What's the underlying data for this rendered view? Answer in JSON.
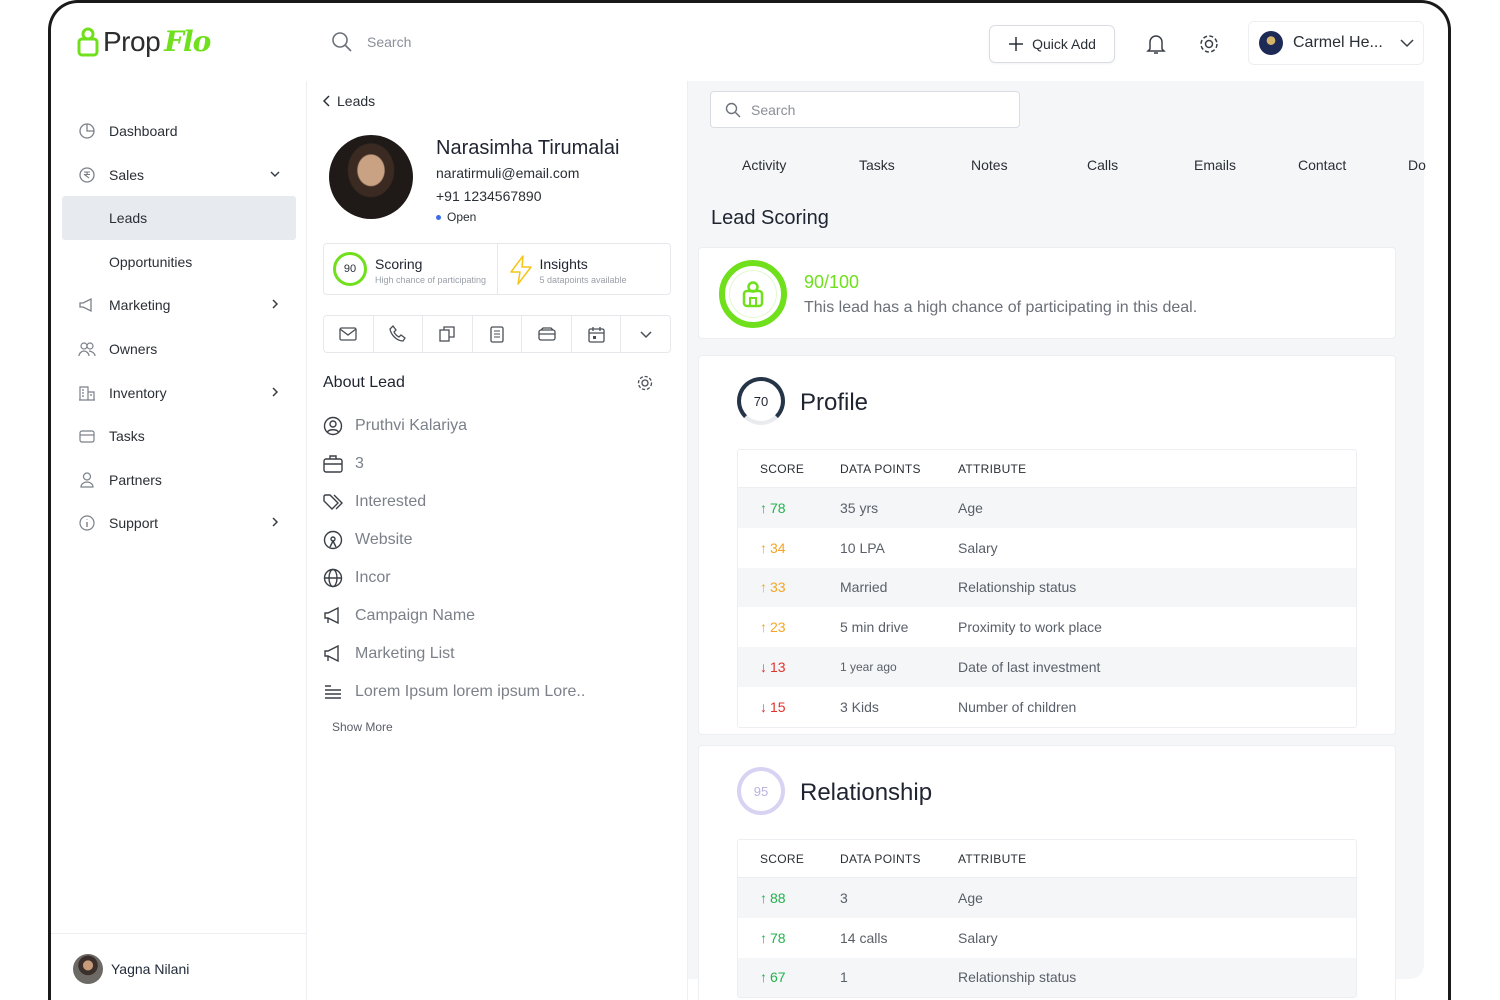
{
  "app": {
    "brand_prefix": "Prop",
    "brand_suffix": "Flo"
  },
  "header": {
    "search_placeholder": "Search",
    "quick_add": "Quick Add",
    "user_name": "Carmel He..."
  },
  "sidebar": {
    "items": [
      {
        "label": "Dashboard",
        "icon": "pie-chart-icon"
      },
      {
        "label": "Sales",
        "icon": "rupee-icon"
      },
      {
        "label": "Leads"
      },
      {
        "label": "Opportunities"
      },
      {
        "label": "Marketing",
        "icon": "megaphone-icon"
      },
      {
        "label": "Owners",
        "icon": "users-icon"
      },
      {
        "label": "Inventory",
        "icon": "building-icon"
      },
      {
        "label": "Tasks",
        "icon": "folder-icon"
      },
      {
        "label": "Partners",
        "icon": "user-icon"
      },
      {
        "label": "Support",
        "icon": "info-icon"
      }
    ],
    "footer_user": "Yagna Nilani"
  },
  "lead": {
    "back_label": "Leads",
    "name": "Narasimha Tirumalai",
    "email": "naratirmuli@email.com",
    "phone": "+91 1234567890",
    "status": "Open",
    "scoring": {
      "value": "90",
      "title": "Scoring",
      "subtitle": "High chance of participating"
    },
    "insights": {
      "title": "Insights",
      "subtitle": "5 datapoints available"
    },
    "about_title": "About Lead",
    "about": [
      "Pruthvi Kalariya",
      "3",
      "Interested",
      "Website",
      "Incor",
      "Campaign Name",
      "Marketing List",
      "Lorem Ipsum lorem ipsum Lore.."
    ],
    "show_more": "Show More"
  },
  "right": {
    "search_placeholder": "Search",
    "tabs": [
      "Activity",
      "Tasks",
      "Notes",
      "Calls",
      "Emails",
      "Contact",
      "Do"
    ],
    "lead_scoring_title": "Lead Scoring",
    "score_value": "90/100",
    "score_desc": "This lead has a high chance of participating in this deal.",
    "columns": [
      "SCORE",
      "DATA POINTS",
      "ATTRIBUTE"
    ],
    "profile": {
      "ring": "70",
      "title": "Profile",
      "rows": [
        {
          "score": "78",
          "dir": "up",
          "tone": "green",
          "data": "35 yrs",
          "attr": "Age"
        },
        {
          "score": "34",
          "dir": "up",
          "tone": "amber",
          "data": "10 LPA",
          "attr": "Salary"
        },
        {
          "score": "33",
          "dir": "up",
          "tone": "amber",
          "data": "Married",
          "attr": "Relationship status"
        },
        {
          "score": "23",
          "dir": "up",
          "tone": "amber",
          "data": "5 min drive",
          "attr": "Proximity to work place"
        },
        {
          "score": "13",
          "dir": "down",
          "tone": "red",
          "data": "1 year ago",
          "attr": "Date of last investment"
        },
        {
          "score": "15",
          "dir": "down",
          "tone": "red",
          "data": "3 Kids",
          "attr": "Number of children"
        }
      ]
    },
    "relationship": {
      "ring": "95",
      "title": "Relationship",
      "rows": [
        {
          "score": "88",
          "dir": "up",
          "tone": "green",
          "data": "3",
          "attr": "Age"
        },
        {
          "score": "78",
          "dir": "up",
          "tone": "green",
          "data": "14 calls",
          "attr": "Salary"
        },
        {
          "score": "67",
          "dir": "up",
          "tone": "green",
          "data": "1",
          "attr": "Relationship status"
        }
      ]
    }
  }
}
